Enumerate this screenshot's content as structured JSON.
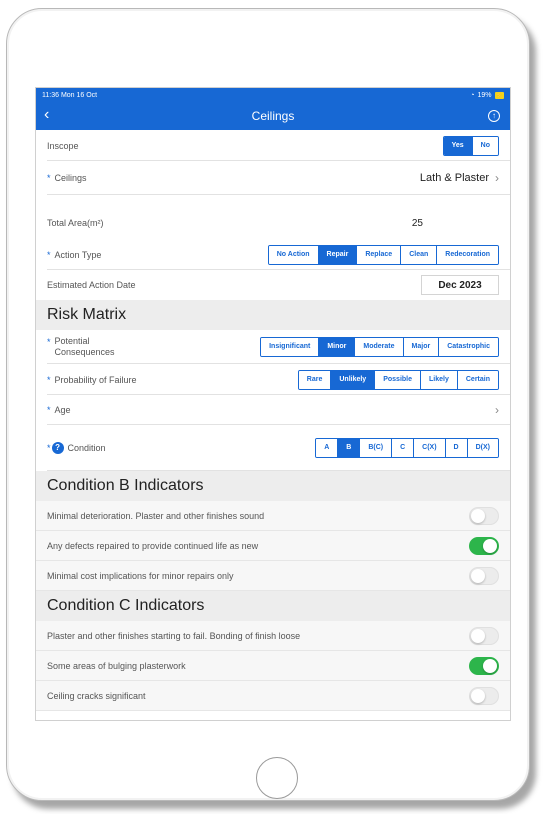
{
  "status": {
    "time": "11:36 Mon 16 Oct",
    "right": "19%",
    "bolt": "⚡"
  },
  "nav": {
    "title": "Ceilings",
    "back": "‹",
    "upload": "↑"
  },
  "inscope": {
    "label": "Inscope",
    "options": [
      "Yes",
      "No"
    ]
  },
  "ceilings": {
    "label": "Ceilings",
    "value": "Lath & Plaster"
  },
  "total_area": {
    "label": "Total Area(m²)",
    "value": "25"
  },
  "action_type": {
    "label": "Action Type",
    "options": [
      "No Action",
      "Repair",
      "Replace",
      "Clean",
      "Redecoration"
    ]
  },
  "action_date": {
    "label": "Estimated Action Date",
    "value": "Dec 2023"
  },
  "risk_matrix": {
    "title": "Risk Matrix"
  },
  "consequences": {
    "label_1": "Potential",
    "label_2": "Consequences",
    "options": [
      "Insignificant",
      "Minor",
      "Moderate",
      "Major",
      "Catastrophic"
    ]
  },
  "probability": {
    "label": "Probability of Failure",
    "options": [
      "Rare",
      "Unlikely",
      "Possible",
      "Likely",
      "Certain"
    ]
  },
  "age": {
    "label": "Age"
  },
  "condition": {
    "label": "Condition",
    "help": "?",
    "options": [
      "A",
      "B",
      "B(C)",
      "C",
      "C(X)",
      "D",
      "D(X)"
    ]
  },
  "cond_b": {
    "title": "Condition B Indicators",
    "items": [
      "Minimal deterioration. Plaster and other finishes sound",
      "Any defects repaired to provide continued life as new",
      "Minimal cost implications for minor repairs only"
    ],
    "states": [
      false,
      true,
      false
    ]
  },
  "cond_c": {
    "title": "Condition C Indicators",
    "items": [
      "Plaster and other finishes starting to fail. Bonding of finish loose",
      "Some areas of bulging plasterwork",
      "Ceiling cracks significant"
    ],
    "states": [
      false,
      true,
      false
    ]
  },
  "colors": {
    "accent": "#1768d4",
    "toggle_on": "#2db54b"
  }
}
